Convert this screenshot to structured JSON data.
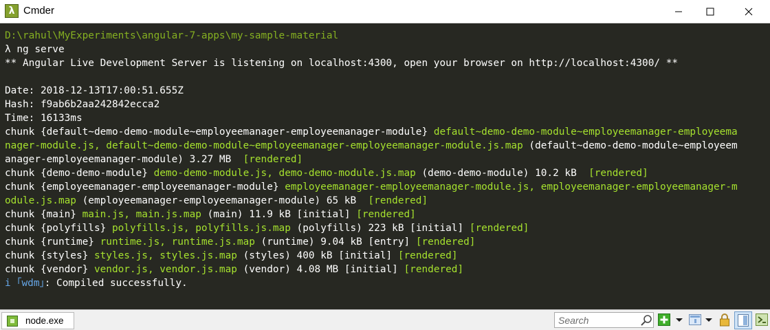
{
  "window": {
    "title": "Cmder",
    "app_icon_glyph": "λ"
  },
  "terminal": {
    "lines": [
      [
        {
          "text": "D:\\rahul\\MyExperiments\\angular-7-apps\\my-sample-material",
          "color": "path"
        }
      ],
      [
        {
          "text": "λ ng serve",
          "color": "white"
        }
      ],
      [
        {
          "text": "** Angular Live Development Server is listening on localhost:4300, open your browser on http://localhost:4300/ **",
          "color": "white"
        }
      ],
      [
        {
          "text": "",
          "color": "white"
        }
      ],
      [
        {
          "text": "Date: 2018-12-13T17:00:51.655Z",
          "color": "white"
        }
      ],
      [
        {
          "text": "Hash: f9ab6b2aa242842ecca2",
          "color": "white"
        }
      ],
      [
        {
          "text": "Time: 16133ms",
          "color": "white"
        }
      ],
      [
        {
          "text": "chunk {default~demo-demo-module~employeemanager-employeemanager-module} ",
          "color": "white"
        },
        {
          "text": "default~demo-demo-module~employeemanager-employeema",
          "color": "green"
        }
      ],
      [
        {
          "text": "nager-module.js, default~demo-demo-module~employeemanager-employeemanager-module.js.map",
          "color": "green"
        },
        {
          "text": " (default~demo-demo-module~employeem",
          "color": "white"
        }
      ],
      [
        {
          "text": "anager-employeemanager-module) 3.27 MB  ",
          "color": "white"
        },
        {
          "text": "[rendered]",
          "color": "green"
        }
      ],
      [
        {
          "text": "chunk {demo-demo-module} ",
          "color": "white"
        },
        {
          "text": "demo-demo-module.js, demo-demo-module.js.map",
          "color": "green"
        },
        {
          "text": " (demo-demo-module) 10.2 kB  ",
          "color": "white"
        },
        {
          "text": "[rendered]",
          "color": "green"
        }
      ],
      [
        {
          "text": "chunk {employeemanager-employeemanager-module} ",
          "color": "white"
        },
        {
          "text": "employeemanager-employeemanager-module.js, employeemanager-employeemanager-m",
          "color": "green"
        }
      ],
      [
        {
          "text": "odule.js.map",
          "color": "green"
        },
        {
          "text": " (employeemanager-employeemanager-module) 65 kB  ",
          "color": "white"
        },
        {
          "text": "[rendered]",
          "color": "green"
        }
      ],
      [
        {
          "text": "chunk {main} ",
          "color": "white"
        },
        {
          "text": "main.js, main.js.map",
          "color": "green"
        },
        {
          "text": " (main) 11.9 kB [initial] ",
          "color": "white"
        },
        {
          "text": "[rendered]",
          "color": "green"
        }
      ],
      [
        {
          "text": "chunk {polyfills} ",
          "color": "white"
        },
        {
          "text": "polyfills.js, polyfills.js.map",
          "color": "green"
        },
        {
          "text": " (polyfills) 223 kB [initial] ",
          "color": "white"
        },
        {
          "text": "[rendered]",
          "color": "green"
        }
      ],
      [
        {
          "text": "chunk {runtime} ",
          "color": "white"
        },
        {
          "text": "runtime.js, runtime.js.map",
          "color": "green"
        },
        {
          "text": " (runtime) 9.04 kB [entry] ",
          "color": "white"
        },
        {
          "text": "[rendered]",
          "color": "green"
        }
      ],
      [
        {
          "text": "chunk {styles} ",
          "color": "white"
        },
        {
          "text": "styles.js, styles.js.map",
          "color": "green"
        },
        {
          "text": " (styles) 400 kB [initial] ",
          "color": "white"
        },
        {
          "text": "[rendered]",
          "color": "green"
        }
      ],
      [
        {
          "text": "chunk {vendor} ",
          "color": "white"
        },
        {
          "text": "vendor.js, vendor.js.map",
          "color": "green"
        },
        {
          "text": " (vendor) 4.08 MB [initial] ",
          "color": "white"
        },
        {
          "text": "[rendered]",
          "color": "green"
        }
      ],
      [
        {
          "text": "i ",
          "color": "info"
        },
        {
          "text": "｢wdm｣",
          "color": "info"
        },
        {
          "text": ": Compiled successfully.",
          "color": "white"
        }
      ]
    ]
  },
  "statusbar": {
    "tab_label": "node.exe",
    "search_placeholder": "Search",
    "icons": [
      "search-icon",
      "new-console-icon",
      "dropdown-arrow-icon",
      "console-list-icon",
      "lock-icon",
      "split-view-icon",
      "menu-icon"
    ]
  },
  "colors": {
    "background": "#272822",
    "text": "#ffffff",
    "green": "#a6e22e",
    "path": "#85b021",
    "info": "#66a6e6"
  }
}
